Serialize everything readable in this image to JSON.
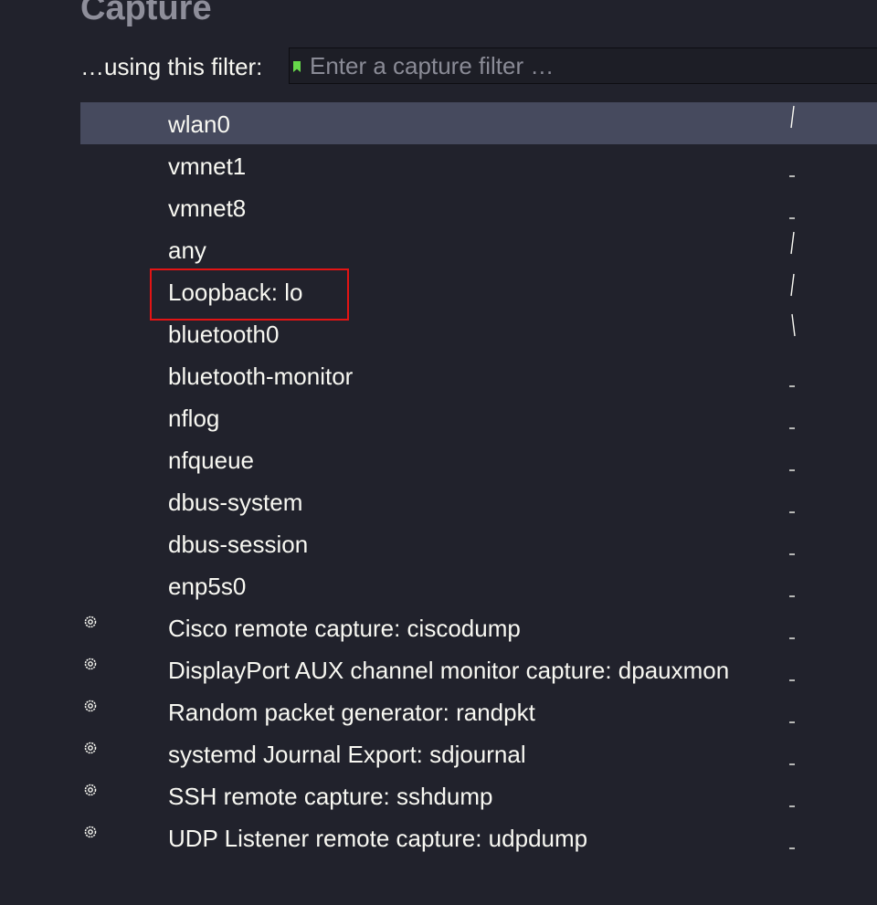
{
  "section": {
    "title": "Capture"
  },
  "filter": {
    "label": "…using this filter:",
    "placeholder": "Enter a capture filter …",
    "value": "",
    "bookmark_color": "#66d94a"
  },
  "interfaces": [
    {
      "name": "wlan0",
      "selected": true,
      "extcap": false,
      "sparkline": "slash"
    },
    {
      "name": "vmnet1",
      "selected": false,
      "extcap": false,
      "sparkline": "flat"
    },
    {
      "name": "vmnet8",
      "selected": false,
      "extcap": false,
      "sparkline": "flat"
    },
    {
      "name": "any",
      "selected": false,
      "extcap": false,
      "sparkline": "slash"
    },
    {
      "name": "Loopback: lo",
      "selected": false,
      "extcap": false,
      "sparkline": "slash",
      "highlighted": true
    },
    {
      "name": "bluetooth0",
      "selected": false,
      "extcap": false,
      "sparkline": "backslash"
    },
    {
      "name": "bluetooth-monitor",
      "selected": false,
      "extcap": false,
      "sparkline": "flat"
    },
    {
      "name": "nflog",
      "selected": false,
      "extcap": false,
      "sparkline": "flat"
    },
    {
      "name": "nfqueue",
      "selected": false,
      "extcap": false,
      "sparkline": "flat"
    },
    {
      "name": "dbus-system",
      "selected": false,
      "extcap": false,
      "sparkline": "flat"
    },
    {
      "name": "dbus-session",
      "selected": false,
      "extcap": false,
      "sparkline": "flat"
    },
    {
      "name": "enp5s0",
      "selected": false,
      "extcap": false,
      "sparkline": "flat"
    },
    {
      "name": "Cisco remote capture: ciscodump",
      "selected": false,
      "extcap": true,
      "sparkline": "flat"
    },
    {
      "name": "DisplayPort AUX channel monitor capture: dpauxmon",
      "selected": false,
      "extcap": true,
      "sparkline": "flat"
    },
    {
      "name": "Random packet generator: randpkt",
      "selected": false,
      "extcap": true,
      "sparkline": "flat"
    },
    {
      "name": "systemd Journal Export: sdjournal",
      "selected": false,
      "extcap": true,
      "sparkline": "flat"
    },
    {
      "name": "SSH remote capture: sshdump",
      "selected": false,
      "extcap": true,
      "sparkline": "flat"
    },
    {
      "name": "UDP Listener remote capture: udpdump",
      "selected": false,
      "extcap": true,
      "sparkline": "flat"
    }
  ],
  "colors": {
    "background": "#21222c",
    "selected_row": "#464a5e",
    "highlight_box": "#e31414",
    "title": "#8e8e9a"
  },
  "icons": {
    "extcap": "gear-icon",
    "filter_bookmark": "bookmark-icon"
  }
}
